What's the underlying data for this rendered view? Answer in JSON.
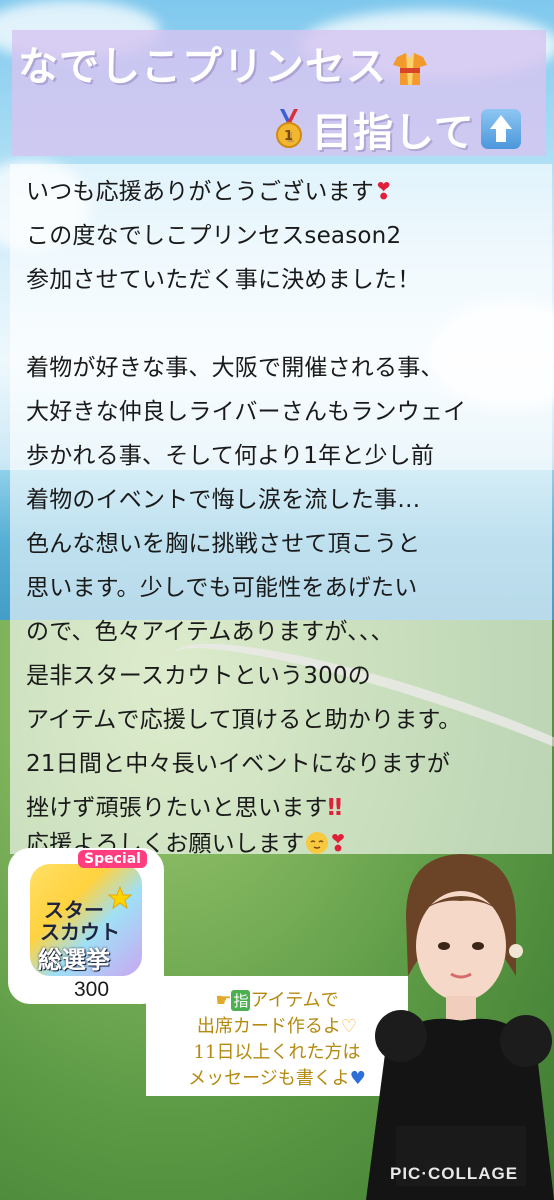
{
  "title": {
    "line1": "なでしこプリンセス",
    "line2": "目指して"
  },
  "message": {
    "lines": [
      "いつも応援ありがとうございます",
      "この度なでしこプリンセスseason2",
      "参加させていただく事に決めました！",
      "",
      "着物が好きな事、大阪で開催される事、",
      "大好きな仲良しライバーさんもランウェイ",
      "歩かれる事、そして何より1年と少し前",
      "着物のイベントで悔し涙を流した事…",
      "色んな想いを胸に挑戦させて頂こうと",
      "思います。少しでも可能性をあげたい",
      "ので、色々アイテムありますが、、、",
      "是非スタースカウトという300の",
      "アイテムで応援して頂けると助かります。",
      "21日間と中々長いイベントになりますが",
      "挫けず頑張りたいと思います",
      "応援よろしくお願いします"
    ]
  },
  "badge": {
    "special": "Special",
    "name_line1": "スター",
    "name_line2": "スカウト",
    "name_line3": "総選挙",
    "value": "300"
  },
  "note": {
    "line1": "アイテムで",
    "line2": "出席カード作るよ",
    "line3": "11日以上くれた方は",
    "line4": "メッセージも書くよ",
    "yubi": "指"
  },
  "watermark": "PIC·COLLAGE",
  "colors": {
    "banner": "#d6c4f0",
    "title_text": "#ffffff",
    "note_text": "#b48a10",
    "heart": "#e0203a"
  },
  "icons": [
    "kimono-icon",
    "medal-icon",
    "up-arrow-icon",
    "heart-exclamation-icon",
    "double-exclamation-icon",
    "relieved-face-icon",
    "pointing-finger-icon",
    "hands-heart-icon",
    "blue-heart-icon"
  ]
}
